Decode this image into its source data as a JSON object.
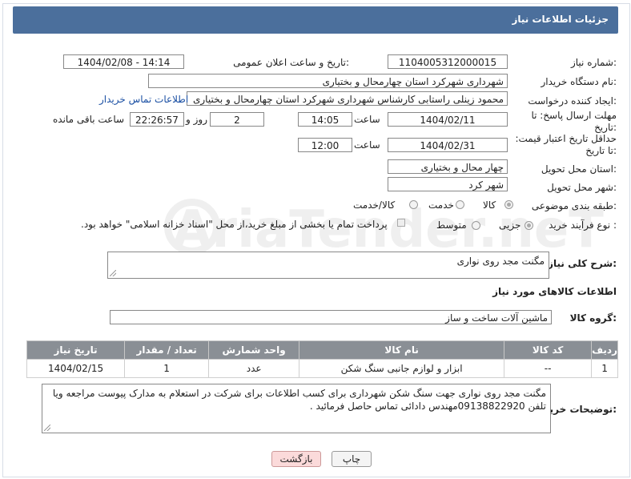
{
  "header": {
    "title": "جزئیات اطلاعات نیاز"
  },
  "watermark": "AriaTender.neT",
  "fields": {
    "need_number_label": "شماره نیاز:",
    "need_number": "1104005312000015",
    "announce_label": "تاریخ و ساعت اعلان عمومی:",
    "announce_value": "1404/02/08 - 14:14",
    "buyer_org_label": "نام دستگاه خریدار:",
    "buyer_org": "شهرداری شهرکرد استان چهارمحال و بختیاری",
    "creator_label": "ایجاد کننده درخواست:",
    "creator": "محمود زینلی راستابی کارشناس شهرداری شهرکرد استان چهارمحال و بختیاری",
    "contact_link": "اطلاعات تماس خریدار",
    "deadline_label": "مهلت ارسال پاسخ: تا تاریخ:",
    "deadline_date": "1404/02/11",
    "time_label": "ساعت",
    "deadline_time": "14:05",
    "days_value": "2",
    "days_label": "روز و",
    "remaining_value": "22:26:57",
    "remaining_label": "ساعت باقی مانده",
    "validity_label": "حداقل تاریخ اعتبار قیمت: تا تاریخ:",
    "validity_date": "1404/02/31",
    "validity_time_label": "ساعت",
    "validity_time": "12:00",
    "province_label": "استان محل تحویل:",
    "province": "چهار محال و بختیاری",
    "city_label": "شهر محل تحویل:",
    "city": "شهر کرد",
    "category_label": "طبقه بندی موضوعی:",
    "category_options": [
      "کالا",
      "خدمت",
      "کالا/خدمت"
    ],
    "process_label": "نوع فرآیند خرید :",
    "process_options": [
      "جزیی",
      "متوسط"
    ],
    "payment_note": "پرداخت تمام یا بخشی از مبلغ خرید،از محل \"اسناد خزانه اسلامی\" خواهد بود."
  },
  "description": {
    "label": "شرح کلی نیاز:",
    "value": "مگنت مجد روی نواری"
  },
  "goods": {
    "section_title": "اطلاعات کالاهای مورد نیاز",
    "group_label": "گروه کالا:",
    "group_value": "ماشین آلات ساخت و ساز"
  },
  "table": {
    "headers": [
      "ردیف",
      "کد کالا",
      "نام کالا",
      "واحد شمارش",
      "تعداد / مقدار",
      "تاریخ نیاز"
    ],
    "rows": [
      [
        "1",
        "--",
        "ابزار و لوازم جانبی سنگ شکن",
        "عدد",
        "1",
        "1404/02/15"
      ]
    ]
  },
  "buyer_notes": {
    "label": "توضیحات خریدار:",
    "value": "مگنت مجد روی نواری جهت سنگ شکن شهرداری برای کسب اطلاعات برای شرکت در استعلام به مدارک پیوست مراجعه ویا تلفن 09138822920مهندس دادائی تماس حاصل فرمائید ."
  },
  "buttons": {
    "print": "چاپ",
    "back": "بازگشت"
  }
}
